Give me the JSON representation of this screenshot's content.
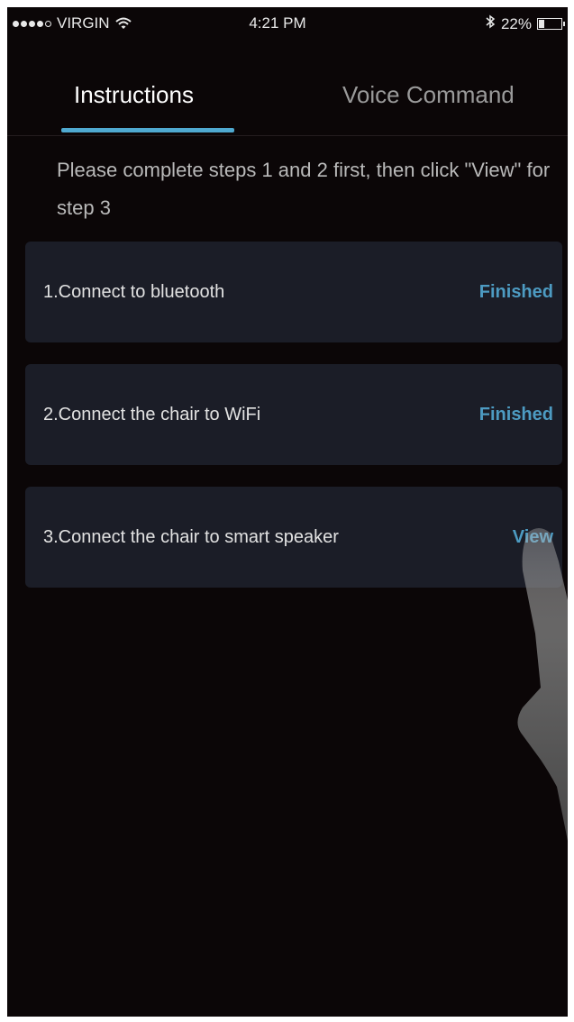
{
  "status_bar": {
    "carrier": "VIRGIN",
    "time": "4:21 PM",
    "battery": "22%",
    "battery_level": 0.22
  },
  "tabs": [
    {
      "label": "Instructions",
      "active": true
    },
    {
      "label": "Voice Command",
      "active": false
    }
  ],
  "intro": "Please complete steps 1 and 2 first, then click \"View\" for step 3",
  "steps": [
    {
      "label": "1.Connect to bluetooth",
      "status": "Finished"
    },
    {
      "label": "2.Connect the chair to WiFi",
      "status": "Finished"
    },
    {
      "label": "3.Connect the chair to smart speaker",
      "status": "View"
    }
  ],
  "colors": {
    "background": "#0b0607",
    "card": "#1b1d27",
    "accent": "#4fa9d0",
    "status_text": "#4d9bc2"
  },
  "icons": [
    "wifi-icon",
    "bluetooth-icon",
    "battery-icon",
    "hand-pointer-icon"
  ]
}
